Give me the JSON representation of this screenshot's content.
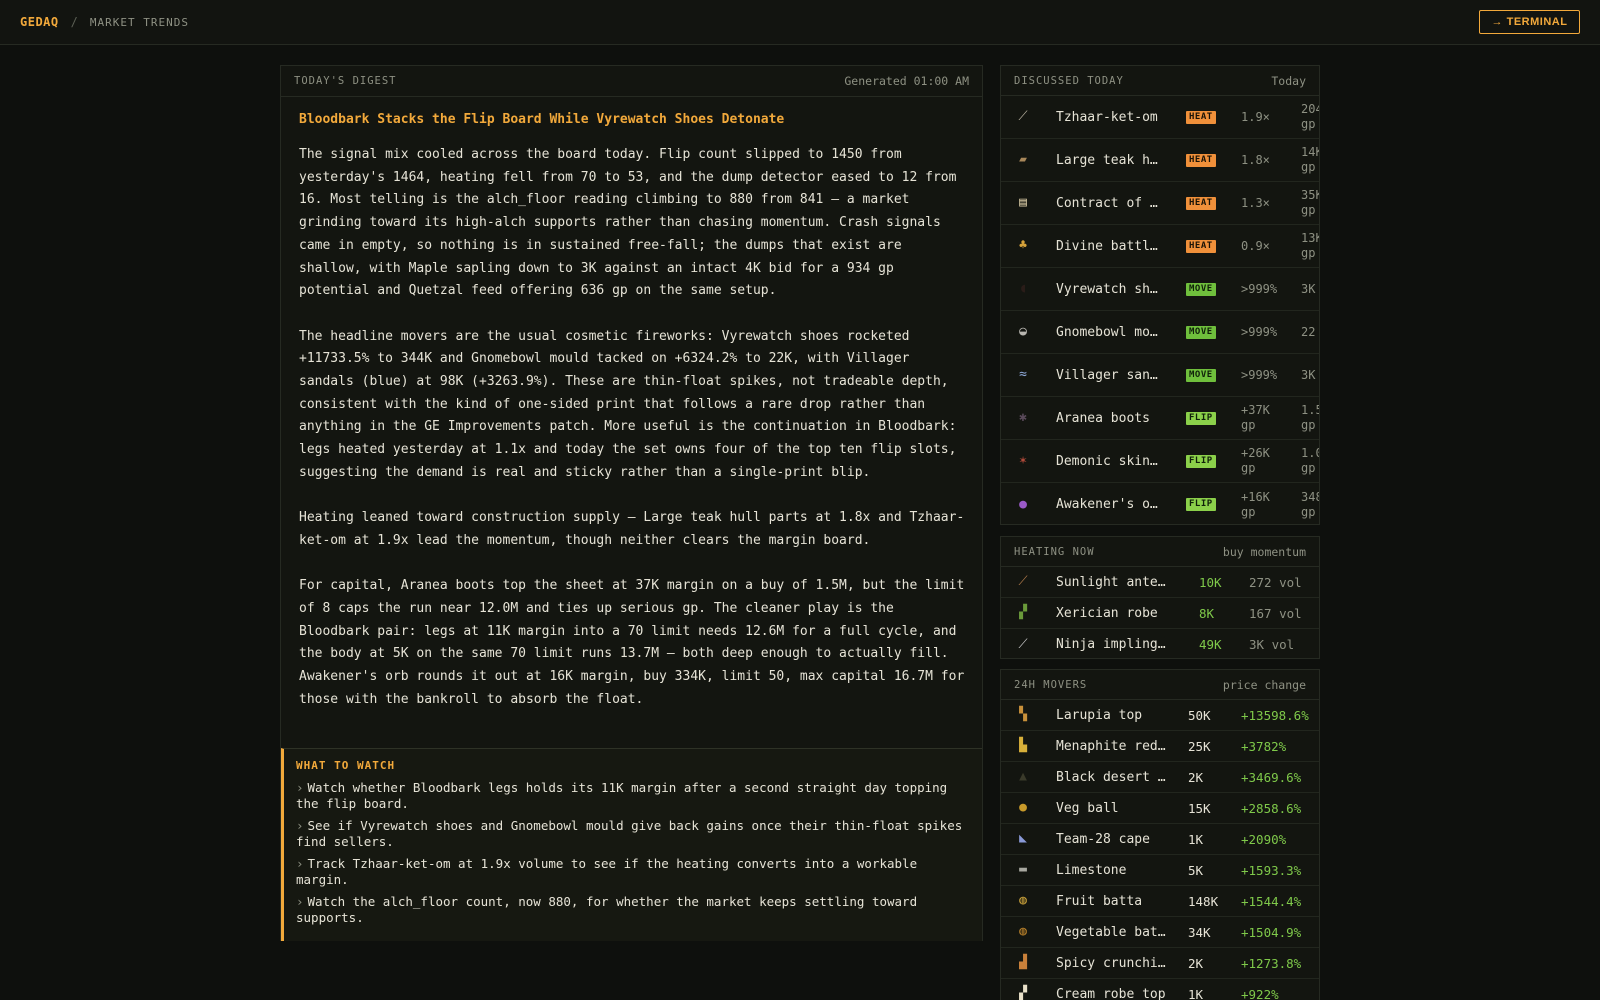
{
  "header": {
    "brand": "GEDAQ",
    "separator": "/",
    "breadcrumb": "MARKET TRENDS",
    "terminal_button": "→ TERMINAL"
  },
  "digest": {
    "label": "TODAY'S DIGEST",
    "generated": "Generated 01:00 AM",
    "title": "Bloodbark Stacks the Flip Board While Vyrewatch Shoes Detonate",
    "paragraphs": [
      "The signal mix cooled across the board today. Flip count slipped to 1450 from yesterday's 1464, heating fell from 70 to 53, and the dump detector eased to 12 from 16. Most telling is the alch_floor reading climbing to 880 from 841 — a market grinding toward its high-alch supports rather than chasing momentum. Crash signals came in empty, so nothing is in sustained free-fall; the dumps that exist are shallow, with Maple sapling down to 3K against an intact 4K bid for a 934 gp potential and Quetzal feed offering 636 gp on the same setup.",
      "The headline movers are the usual cosmetic fireworks: Vyrewatch shoes rocketed +11733.5% to 344K and Gnomebowl mould tacked on +6324.2% to 22K, with Villager sandals (blue) at 98K (+3263.9%). These are thin-float spikes, not tradeable depth, consistent with the kind of one-sided print that follows a rare drop rather than anything in the GE Improvements patch. More useful is the continuation in Bloodbark: legs heated yesterday at 1.1x and today the set owns four of the top ten flip slots, suggesting the demand is real and sticky rather than a single-print blip.",
      "Heating leaned toward construction supply — Large teak hull parts at 1.8x and Tzhaar-ket-om at 1.9x lead the momentum, though neither clears the margin board.",
      "For capital, Aranea boots top the sheet at 37K margin on a buy of 1.5M, but the limit of 8 caps the run near 12.0M and ties up serious gp. The cleaner play is the Bloodbark pair: legs at 11K margin into a 70 limit needs 12.6M for a full cycle, and the body at 5K on the same 70 limit runs 13.7M — both deep enough to actually fill. Awakener's orb rounds it out at 16K margin, buy 334K, limit 50, max capital 16.7M for those with the bankroll to absorb the float."
    ],
    "watch_title": "WHAT TO WATCH",
    "watch_chevron": "›",
    "watch_items": [
      "Watch whether Bloodbark legs holds its 11K margin after a second straight day topping the flip board.",
      "See if Vyrewatch shoes and Gnomebowl mould give back gains once their thin-float spikes find sellers.",
      "Track Tzhaar-ket-om at 1.9x volume to see if the heating converts into a workable margin.",
      "Watch the alch_floor count, now 880, for whether the market keeps settling toward supports."
    ]
  },
  "discussed": {
    "label": "DISCUSSED TODAY",
    "right": "Today",
    "items": [
      {
        "icon": "club-icon",
        "glyph": "⟋",
        "color": "#b9b2a0",
        "name": "Tzhaar-ket-om",
        "badge": "HEAT",
        "metric": "1.9×",
        "value": "204 gp"
      },
      {
        "icon": "hull-parts-icon",
        "glyph": "▰",
        "color": "#a8875a",
        "name": "Large teak hu…",
        "badge": "HEAT",
        "metric": "1.8×",
        "value": "14K gp"
      },
      {
        "icon": "contract-icon",
        "glyph": "▤",
        "color": "#d8c9a4",
        "name": "Contract of f…",
        "badge": "HEAT",
        "metric": "1.3×",
        "value": "35K gp"
      },
      {
        "icon": "potion-icon",
        "glyph": "♣",
        "color": "#d6a23a",
        "name": "Divine battle…",
        "badge": "HEAT",
        "metric": "0.9×",
        "value": "13K gp"
      },
      {
        "icon": "boots-icon",
        "glyph": "◖",
        "color": "#2a1c18",
        "name": "Vyrewatch sho…",
        "badge": "MOVE",
        "metric": ">999%",
        "value": "3K gp"
      },
      {
        "icon": "mould-icon",
        "glyph": "◒",
        "color": "#b8b6b0",
        "name": "Gnomebowl mou…",
        "badge": "MOVE",
        "metric": ">999%",
        "value": "22 gp"
      },
      {
        "icon": "sandals-icon",
        "glyph": "≈",
        "color": "#8ea8d8",
        "name": "Villager sand…",
        "badge": "MOVE",
        "metric": ">999%",
        "value": "3K gp"
      },
      {
        "icon": "spider-boots-icon",
        "glyph": "✱",
        "color": "#5a4a5a",
        "name": "Aranea boots",
        "badge": "FLIP",
        "metric": "+37K gp",
        "value": "1.5 gp"
      },
      {
        "icon": "demonic-skin-icon",
        "glyph": "✶",
        "color": "#b04a3a",
        "name": "Demonic skin …",
        "badge": "FLIP",
        "metric": "+26K gp",
        "value": "1.0 gp"
      },
      {
        "icon": "orb-icon",
        "glyph": "●",
        "color": "#9a5ac8",
        "name": "Awakener's orb",
        "badge": "FLIP",
        "metric": "+16K gp",
        "value": "348 gp"
      }
    ]
  },
  "heating": {
    "label": "HEATING NOW",
    "right": "buy momentum",
    "items": [
      {
        "icon": "antelope-icon",
        "glyph": "⟋",
        "color": "#b07a4a",
        "name": "Sunlight antelo…",
        "price": "10K",
        "vol": "272 vol"
      },
      {
        "icon": "robe-icon",
        "glyph": "▞",
        "color": "#6a9a3a",
        "name": "Xerician robe",
        "price": "8K",
        "vol": "167 vol"
      },
      {
        "icon": "impling-jar-icon",
        "glyph": "⟋",
        "color": "#c8c8c8",
        "name": "Ninja impling j…",
        "price": "49K",
        "vol": "3K vol"
      }
    ]
  },
  "movers": {
    "label": "24H MOVERS",
    "right": "price change",
    "items": [
      {
        "icon": "larupia-top-icon",
        "glyph": "▚",
        "color": "#c8903a",
        "name": "Larupia top",
        "price": "50K",
        "change": "+13598.6%"
      },
      {
        "icon": "menaphite-icon",
        "glyph": "▙",
        "color": "#d8b03a",
        "name": "Menaphite red …",
        "price": "25K",
        "change": "+3782%"
      },
      {
        "icon": "desert-robe-icon",
        "glyph": "▲",
        "color": "#3a3a2a",
        "name": "Black desert r…",
        "price": "2K",
        "change": "+3469.6%"
      },
      {
        "icon": "veg-ball-icon",
        "glyph": "●",
        "color": "#c89a2a",
        "name": "Veg ball",
        "price": "15K",
        "change": "+2858.6%"
      },
      {
        "icon": "cape-icon",
        "glyph": "◣",
        "color": "#8a9ad8",
        "name": "Team-28 cape",
        "price": "1K",
        "change": "+2090%"
      },
      {
        "icon": "limestone-icon",
        "glyph": "▬",
        "color": "#a8a8a0",
        "name": "Limestone",
        "price": "5K",
        "change": "+1593.3%"
      },
      {
        "icon": "fruit-batta-icon",
        "glyph": "◍",
        "color": "#c8a03a",
        "name": "Fruit batta",
        "price": "148K",
        "change": "+1544.4%"
      },
      {
        "icon": "veg-batta-icon",
        "glyph": "◍",
        "color": "#b8802a",
        "name": "Vegetable batta",
        "price": "34K",
        "change": "+1504.9%"
      },
      {
        "icon": "crunchies-icon",
        "glyph": "▟",
        "color": "#c8803a",
        "name": "Spicy crunchies",
        "price": "2K",
        "change": "+1273.8%"
      },
      {
        "icon": "cream-robe-icon",
        "glyph": "▞",
        "color": "#e8e0c8",
        "name": "Cream robe top",
        "price": "1K",
        "change": "+922%"
      }
    ]
  },
  "colors": {
    "accent": "#f2a93b",
    "positive": "#7fc94a",
    "heat_badge": "#f0903a",
    "move_badge": "#6fbf3c",
    "flip_badge": "#8bd04a"
  }
}
